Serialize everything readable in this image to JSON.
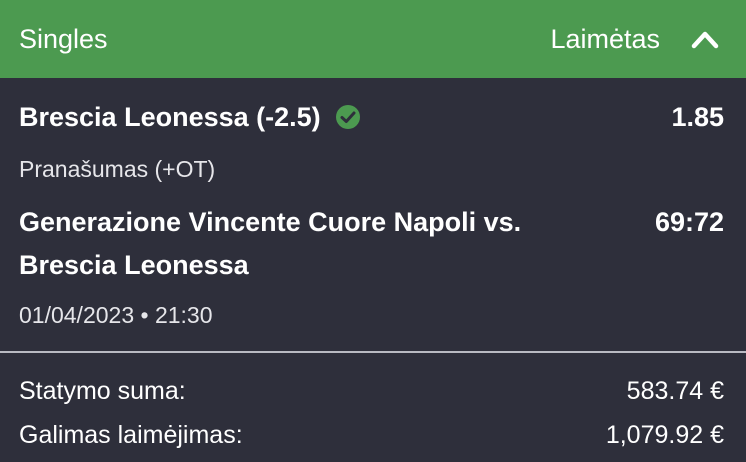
{
  "header": {
    "title": "Singles",
    "status": "Laimėtas",
    "status_color": "#4c9a50"
  },
  "bet": {
    "selection": "Brescia Leonessa (-2.5)",
    "selection_status_icon": "check-circle-icon",
    "odds": "1.85",
    "market": "Pranašumas (+OT)",
    "event_line1": "Generazione Vincente Cuore Napoli vs.",
    "event_line2": "Brescia Leonessa",
    "score": "69:72",
    "datetime": "01/04/2023 • 21:30"
  },
  "summary": {
    "stake_label": "Statymo suma:",
    "stake_value": "583.74 €",
    "win_label": "Galimas laimėjimas:",
    "win_value": "1,079.92 €"
  },
  "colors": {
    "background": "#2e2f3b",
    "header": "#4c9a50",
    "check": "#4c9a50"
  }
}
